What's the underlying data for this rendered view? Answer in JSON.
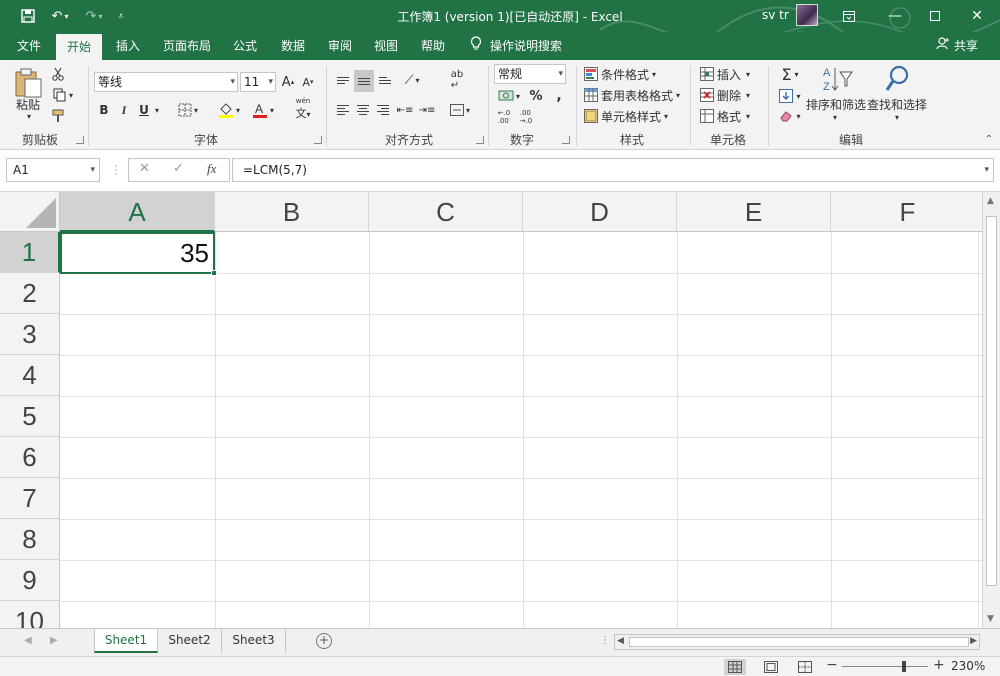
{
  "window": {
    "title": "工作簿1 (version 1)[已自动还原]  -  Excel",
    "user": "sv tr"
  },
  "tabs": [
    "文件",
    "开始",
    "插入",
    "页面布局",
    "公式",
    "数据",
    "审阅",
    "视图",
    "帮助"
  ],
  "tell_me": "操作说明搜索",
  "share": "共享",
  "ribbon": {
    "clipboard": {
      "label": "剪贴板",
      "paste": "粘贴"
    },
    "font": {
      "label": "字体",
      "name": "等线",
      "size": "11",
      "bold": "B",
      "italic": "I",
      "underline": "U",
      "phonetic": "wén"
    },
    "alignment": {
      "label": "对齐方式"
    },
    "number": {
      "label": "数字",
      "format": "常规",
      "percent": "%"
    },
    "styles": {
      "label": "样式",
      "conditional": "条件格式",
      "table": "套用表格格式",
      "cell": "单元格样式"
    },
    "cells": {
      "label": "单元格",
      "insert": "插入",
      "delete": "删除",
      "format": "格式"
    },
    "editing": {
      "label": "编辑",
      "sort_filter": "排序和筛选",
      "find_select": "查找和选择"
    }
  },
  "formula_bar": {
    "name_box": "A1",
    "formula": "=LCM(5,7)",
    "fx": "fx"
  },
  "grid": {
    "columns": [
      "A",
      "B",
      "C",
      "D",
      "E",
      "F"
    ],
    "rows": [
      "1",
      "2",
      "3",
      "4",
      "5",
      "6",
      "7",
      "8",
      "9",
      "10"
    ],
    "active_cell_value": "35"
  },
  "sheets": [
    "Sheet1",
    "Sheet2",
    "Sheet3"
  ],
  "status": {
    "zoom": "230%"
  },
  "colors": {
    "accent": "#217346",
    "ribbon_bg": "#f3f3f3"
  }
}
